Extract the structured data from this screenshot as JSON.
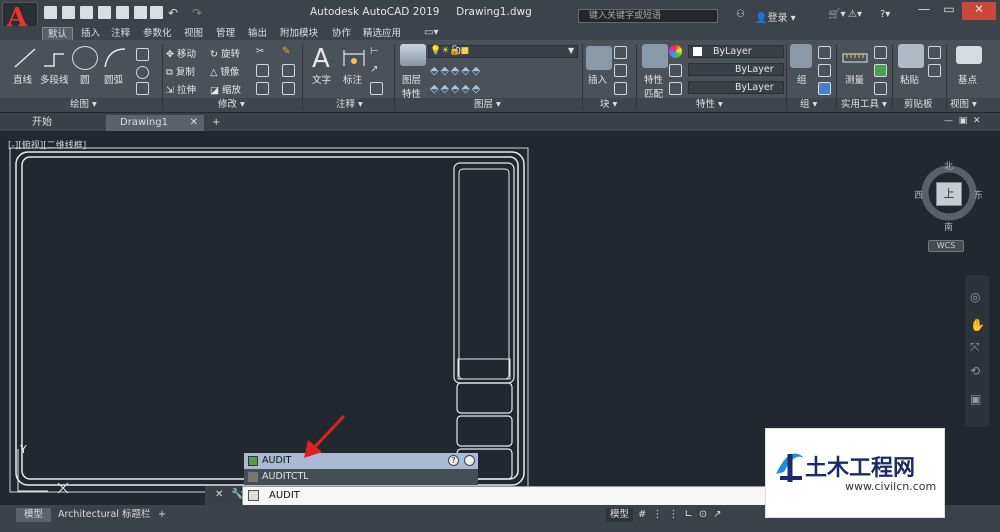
{
  "app": {
    "title": "Autodesk AutoCAD 2019",
    "document": "Drawing1.dwg",
    "logo_letter": "A"
  },
  "search": {
    "placeholder": "键入关键字或短语"
  },
  "login": {
    "label": "登录"
  },
  "ribbon_tabs": [
    "默认",
    "插入",
    "注释",
    "参数化",
    "视图",
    "管理",
    "输出",
    "附加模块",
    "协作",
    "精选应用"
  ],
  "draw": {
    "line": "直线",
    "polyline": "多段线",
    "circle": "圆",
    "arc": "圆弧",
    "panel": "绘图"
  },
  "modify": {
    "move": "移动",
    "rotate": "旋转",
    "copy": "复制",
    "mirror": "镜像",
    "stretch": "拉伸",
    "scale": "缩放",
    "panel": "修改"
  },
  "annotation": {
    "text": "文字",
    "dimension": "标注",
    "panel": "注释"
  },
  "layers": {
    "properties_l1": "图层",
    "properties_l2": "特性",
    "current": "0",
    "panel": "图层"
  },
  "block": {
    "insert": "插入",
    "panel": "块"
  },
  "properties": {
    "match_l1": "特性",
    "match_l2": "匹配",
    "color": "ByLayer",
    "linetype": "ByLayer",
    "lineweight": "ByLayer",
    "panel": "特性"
  },
  "groups": {
    "group": "组",
    "panel": "组"
  },
  "utilities": {
    "measure": "测量",
    "panel": "实用工具"
  },
  "clipboard": {
    "paste": "粘贴",
    "panel": "剪贴板"
  },
  "view": {
    "base": "基点",
    "panel": "视图"
  },
  "doc_tabs": {
    "start": "开始",
    "drawing": "Drawing1",
    "add": "+"
  },
  "viewport": {
    "label": "[-][俯视][二维线框]"
  },
  "viewcube": {
    "north": "北",
    "south": "南",
    "east": "东",
    "west": "西",
    "top": "上",
    "wcs": "WCS"
  },
  "command": {
    "input": "AUDIT",
    "suggestions": [
      "AUDIT",
      "AUDITCTL"
    ]
  },
  "status": {
    "model_tab": "模型",
    "layout_tab": "Architectural 标题栏",
    "add": "+",
    "model_button": "模型"
  },
  "watermark": {
    "text": "土木工程网",
    "url": "www.civilcn.com"
  },
  "colors": {
    "accent": "#e33",
    "ribbon": "#4a5159",
    "canvas": "#212830",
    "suggestion_active": "#aab9d4"
  }
}
